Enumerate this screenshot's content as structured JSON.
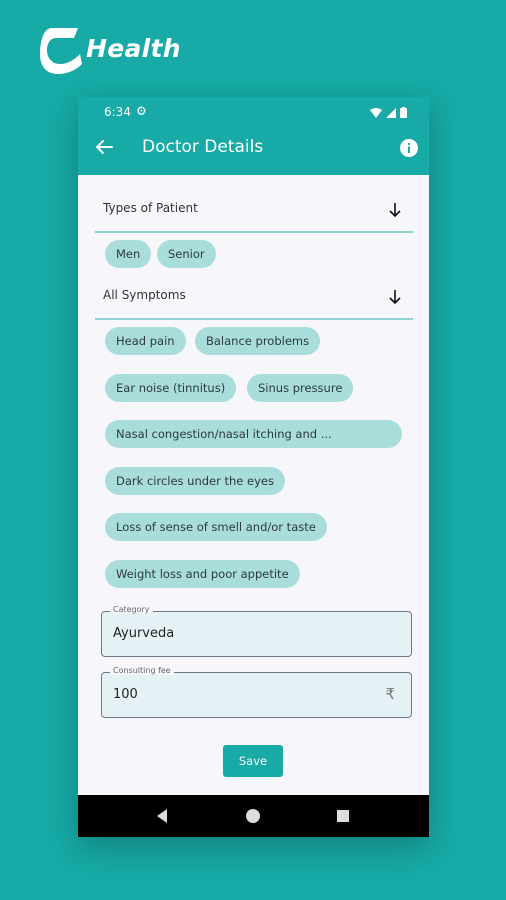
{
  "brand": {
    "name": "Health"
  },
  "status_bar": {
    "time": "6:34"
  },
  "toolbar": {
    "title": "Doctor Details"
  },
  "patient_types": {
    "label": "Types of Patient",
    "chips": [
      "Men",
      "Senior"
    ]
  },
  "symptoms": {
    "label": "All Symptoms",
    "chips": [
      "Head pain",
      "Balance problems",
      "Ear noise (tinnitus)",
      "Sinus pressure",
      "Nasal congestion/nasal itching and ...",
      "Dark circles under the eyes",
      "Loss of sense of smell and/or taste",
      "Weight loss and poor appetite"
    ]
  },
  "category": {
    "label": "Category",
    "value": "Ayurveda"
  },
  "fee": {
    "label": "Consulting fee",
    "value": "100",
    "currency_symbol": "₹"
  },
  "save_label": "Save",
  "colors": {
    "primary": "#17aaa6",
    "chip": "#a9dddc",
    "field_bg": "#e6f1f6"
  }
}
